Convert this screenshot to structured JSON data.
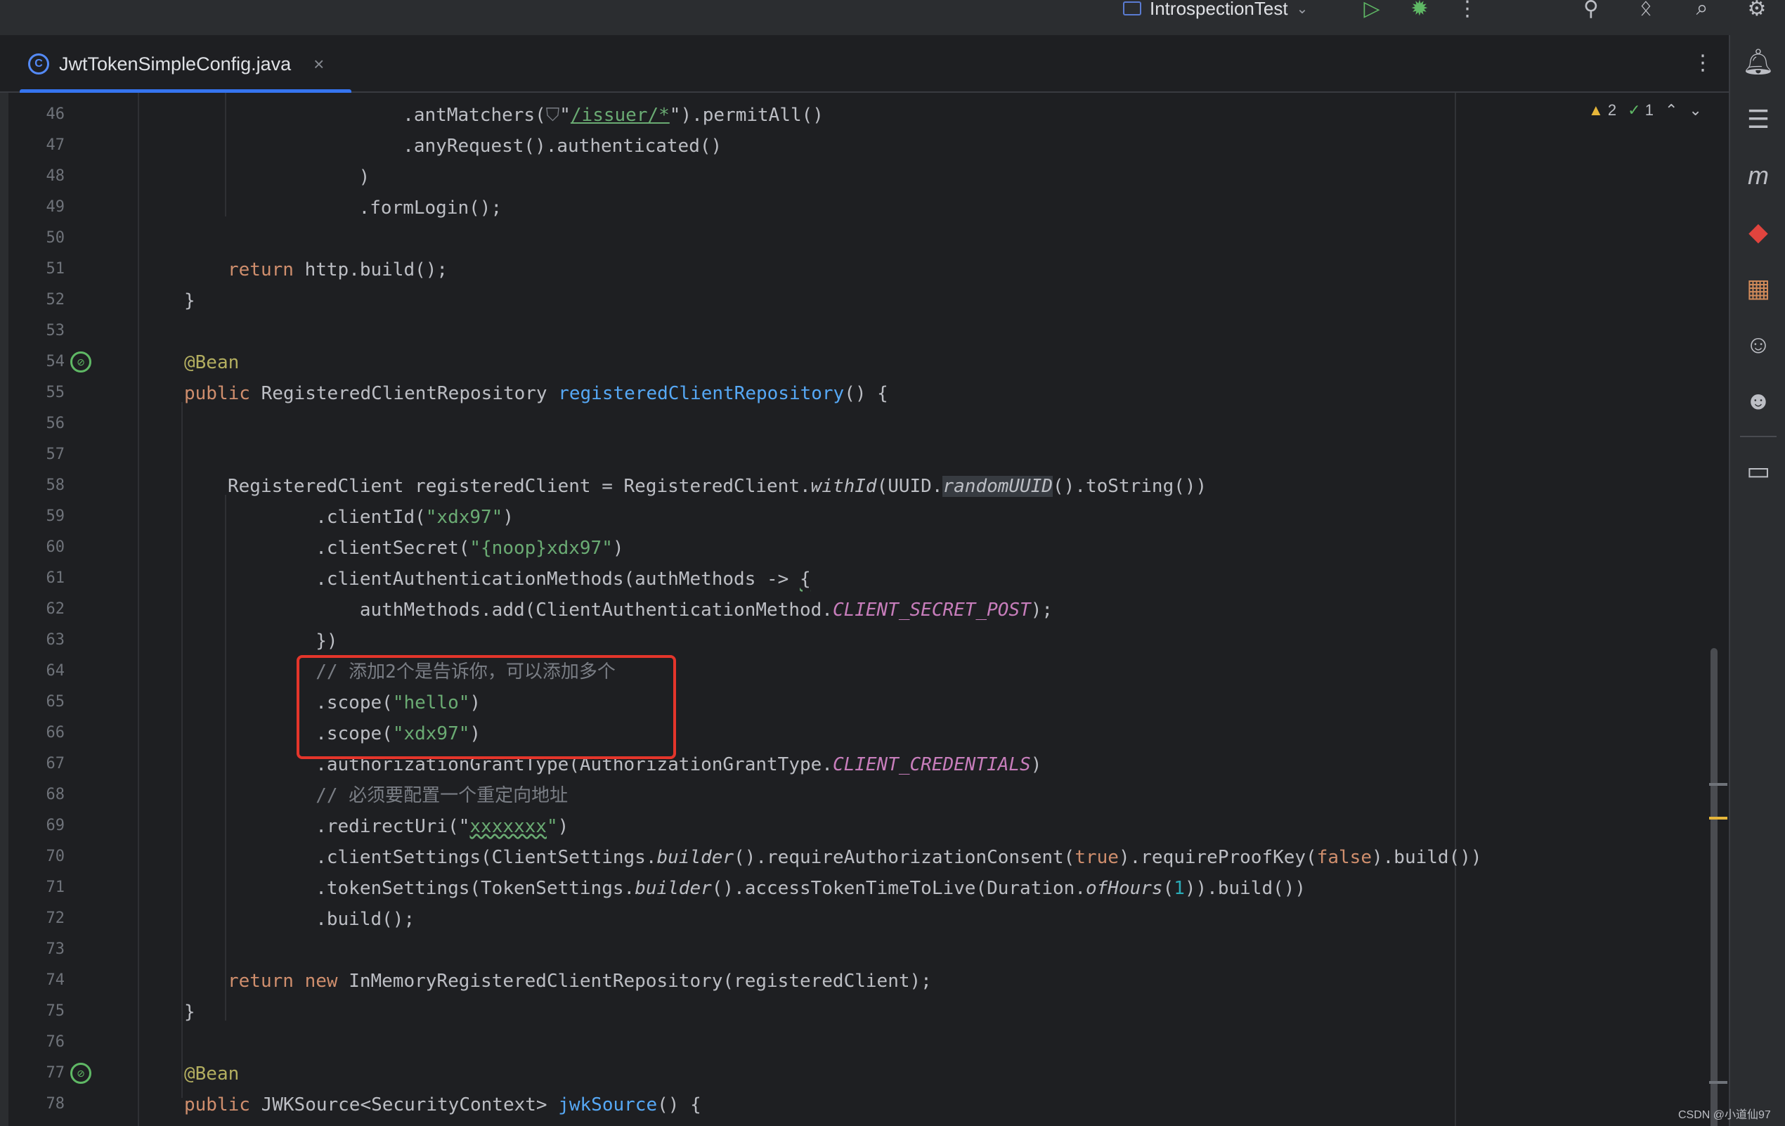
{
  "titlebar": {
    "run_config": "IntrospectionTest",
    "icons": [
      "add-user-icon",
      "translate-icon",
      "search-icon",
      "settings-icon"
    ],
    "run_icon": "run-icon",
    "debug_icon": "debug-icon",
    "more_icon": "more-vertical-icon"
  },
  "tab": {
    "filename": "JwtTokenSimpleConfig.java",
    "badge": "C",
    "close": "×",
    "more": "⋮"
  },
  "inspections": {
    "warnings": "2",
    "ok": "1"
  },
  "lines": [
    {
      "n": "46",
      "segs": [
        {
          "t": "        .antMatchers("
        },
        {
          "t": "⛉",
          "c": "cm"
        },
        {
          "t": "\""
        },
        {
          "t": "/issuer/*",
          "c": "str ul"
        },
        {
          "t": "\").permitAll()"
        }
      ]
    },
    {
      "n": "47",
      "segs": [
        {
          "t": "        .anyRequest().authenticated()"
        }
      ]
    },
    {
      "n": "48",
      "segs": [
        {
          "t": "    )"
        }
      ]
    },
    {
      "n": "49",
      "segs": [
        {
          "t": "    .formLogin();"
        }
      ]
    },
    {
      "n": "50",
      "segs": []
    },
    {
      "n": "51",
      "segs": [
        {
          "t": "return ",
          "c": "kw"
        },
        {
          "t": "http.build();"
        }
      ]
    },
    {
      "n": "52",
      "segs": [
        {
          "t": "}"
        }
      ]
    },
    {
      "n": "53",
      "segs": []
    },
    {
      "n": "54",
      "segs": [
        {
          "t": "@Bean",
          "c": "ann"
        }
      ]
    },
    {
      "n": "55",
      "segs": [
        {
          "t": "public ",
          "c": "kw"
        },
        {
          "t": "RegisteredClientRepository "
        },
        {
          "t": "registeredClientRepository",
          "c": "fn"
        },
        {
          "t": "() {"
        }
      ]
    },
    {
      "n": "56",
      "segs": []
    },
    {
      "n": "57",
      "segs": []
    },
    {
      "n": "58",
      "segs": [
        {
          "t": "RegisteredClient registeredClient = RegisteredClient."
        },
        {
          "t": "withId",
          "c": "it"
        },
        {
          "t": "(UUID."
        },
        {
          "t": "randomUUID",
          "c": "it hl"
        },
        {
          "t": "().toString())"
        }
      ]
    },
    {
      "n": "59",
      "segs": [
        {
          "t": "        .clientId("
        },
        {
          "t": "\"xdx97\"",
          "c": "str"
        },
        {
          "t": ")"
        }
      ]
    },
    {
      "n": "60",
      "segs": [
        {
          "t": "        .clientSecret("
        },
        {
          "t": "\"{noop}xdx97\"",
          "c": "str"
        },
        {
          "t": ")"
        }
      ]
    },
    {
      "n": "61",
      "segs": [
        {
          "t": "        .clientAuthenticationMethods(authMethods -> "
        },
        {
          "t": "{",
          "c": "sq"
        }
      ]
    },
    {
      "n": "62",
      "segs": [
        {
          "t": "            authMethods.add(ClientAuthenticationMethod."
        },
        {
          "t": "CLIENT_SECRET_POST",
          "c": "cst"
        },
        {
          "t": ");"
        }
      ]
    },
    {
      "n": "63",
      "segs": [
        {
          "t": "        })"
        }
      ]
    },
    {
      "n": "64",
      "segs": [
        {
          "t": "        // 添加2个是告诉你，可以添加多个",
          "c": "cm"
        }
      ]
    },
    {
      "n": "65",
      "segs": [
        {
          "t": "        .scope("
        },
        {
          "t": "\"hello\"",
          "c": "str"
        },
        {
          "t": ")"
        }
      ]
    },
    {
      "n": "66",
      "segs": [
        {
          "t": "        .scope("
        },
        {
          "t": "\"xdx97\"",
          "c": "str"
        },
        {
          "t": ")"
        }
      ]
    },
    {
      "n": "67",
      "segs": [
        {
          "t": "        .authorizationGrantType(AuthorizationGrantType."
        },
        {
          "t": "CLIENT_CREDENTIALS",
          "c": "cst"
        },
        {
          "t": ")"
        }
      ]
    },
    {
      "n": "68",
      "segs": [
        {
          "t": "        // 必须要配置一个重定向地址",
          "c": "cm"
        }
      ]
    },
    {
      "n": "69",
      "segs": [
        {
          "t": "        .redirectUri("
        },
        {
          "t": "\""
        },
        {
          "t": "xxxxxxx",
          "c": "str sq"
        },
        {
          "t": "\"",
          "c": "str"
        },
        {
          "t": ")"
        }
      ]
    },
    {
      "n": "70",
      "segs": [
        {
          "t": "        .clientSettings(ClientSettings."
        },
        {
          "t": "builder",
          "c": "it"
        },
        {
          "t": "().requireAuthorizationConsent("
        },
        {
          "t": "true",
          "c": "kw"
        },
        {
          "t": ").requireProofKey("
        },
        {
          "t": "false",
          "c": "kw"
        },
        {
          "t": ").build())"
        }
      ]
    },
    {
      "n": "71",
      "segs": [
        {
          "t": "        .tokenSettings(TokenSettings."
        },
        {
          "t": "builder",
          "c": "it"
        },
        {
          "t": "().accessTokenTimeToLive(Duration."
        },
        {
          "t": "ofHours",
          "c": "it"
        },
        {
          "t": "("
        },
        {
          "t": "1",
          "c": "num"
        },
        {
          "t": ")).build())"
        }
      ]
    },
    {
      "n": "72",
      "segs": [
        {
          "t": "        .build();"
        }
      ]
    },
    {
      "n": "73",
      "segs": []
    },
    {
      "n": "74",
      "segs": [
        {
          "t": "return new ",
          "c": "kw"
        },
        {
          "t": "InMemoryRegisteredClientRepository(registeredClient);"
        }
      ]
    },
    {
      "n": "75",
      "segs": [
        {
          "t": "}"
        }
      ]
    },
    {
      "n": "76",
      "segs": []
    },
    {
      "n": "77",
      "segs": [
        {
          "t": "@Bean",
          "c": "ann"
        }
      ]
    },
    {
      "n": "78",
      "segs": [
        {
          "t": "public ",
          "c": "kw"
        },
        {
          "t": "JWKSource<SecurityContext> "
        },
        {
          "t": "jwkSource",
          "c": "fn"
        },
        {
          "t": "() {"
        }
      ]
    }
  ],
  "watermark": "CSDN @小道仙97"
}
